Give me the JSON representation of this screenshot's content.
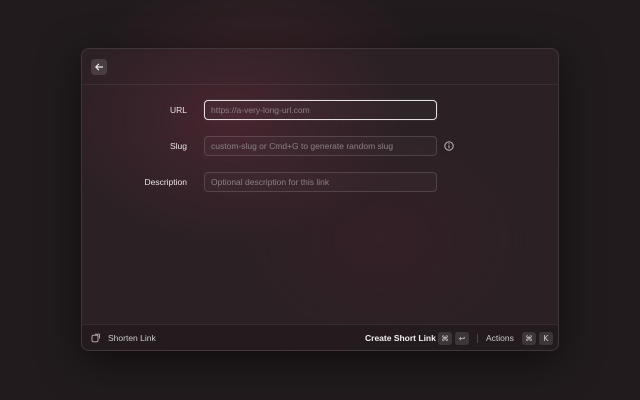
{
  "form": {
    "fields": [
      {
        "label": "URL",
        "value": "",
        "placeholder": "https://a-very-long-url.com"
      },
      {
        "label": "Slug",
        "value": "",
        "placeholder": "custom-slug or Cmd+G to generate random slug"
      },
      {
        "label": "Description",
        "value": "",
        "placeholder": "Optional description for this link"
      }
    ]
  },
  "footer": {
    "command_title": "Shorten Link",
    "primary_action": "Create Short Link",
    "primary_shortcut": [
      "⌘",
      "↩"
    ],
    "secondary_action": "Actions",
    "secondary_shortcut": [
      "⌘",
      "K"
    ]
  },
  "icons": {
    "back": "arrow-left-icon",
    "slug_info": "info-icon",
    "command": "link-command-icon"
  },
  "colors": {
    "background": "#211b1d",
    "window": "#2a2125",
    "accent_glow": "#5f2837",
    "focus_border": "#e3dde0"
  }
}
